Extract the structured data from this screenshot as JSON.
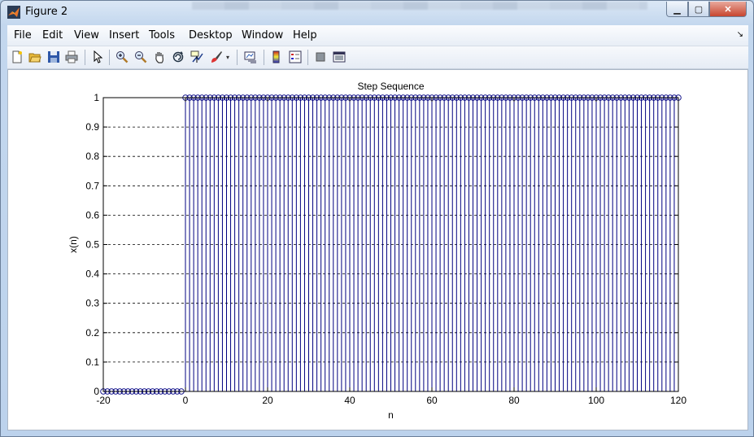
{
  "window": {
    "title": "Figure 2"
  },
  "menu": {
    "items": [
      "File",
      "Edit",
      "View",
      "Insert",
      "Tools",
      "Desktop",
      "Window",
      "Help"
    ]
  },
  "icons": {
    "toolbar": [
      "new-figure-icon",
      "open-icon",
      "save-icon",
      "print-icon",
      "pointer-icon",
      "zoom-in-icon",
      "zoom-out-icon",
      "pan-hand-icon",
      "rotate-3d-icon",
      "data-cursor-icon",
      "brush-icon",
      "brush-dropdown-icon",
      "link-plot-icon",
      "colorbar-icon",
      "legend-icon",
      "hide-plot-tools-icon",
      "show-plot-tools-icon"
    ]
  },
  "colors": {
    "stem": "#000080",
    "grid": "#000000",
    "close": "#c7452f"
  },
  "chart_data": {
    "type": "stem",
    "title": "Step Sequence",
    "xlabel": "n",
    "ylabel": "x(n)",
    "xlim": [
      -20,
      120
    ],
    "ylim": [
      0,
      1
    ],
    "x_ticks": [
      "-20",
      "0",
      "20",
      "40",
      "60",
      "80",
      "100",
      "120"
    ],
    "y_ticks": [
      "0",
      "0.1",
      "0.2",
      "0.3",
      "0.4",
      "0.5",
      "0.6",
      "0.7",
      "0.8",
      "0.9",
      "1"
    ],
    "grid": "y-dashed",
    "series": [
      {
        "x_start": -20,
        "x_end": 120,
        "step_at": 0,
        "value_before": 0,
        "value_after": 1
      }
    ]
  }
}
